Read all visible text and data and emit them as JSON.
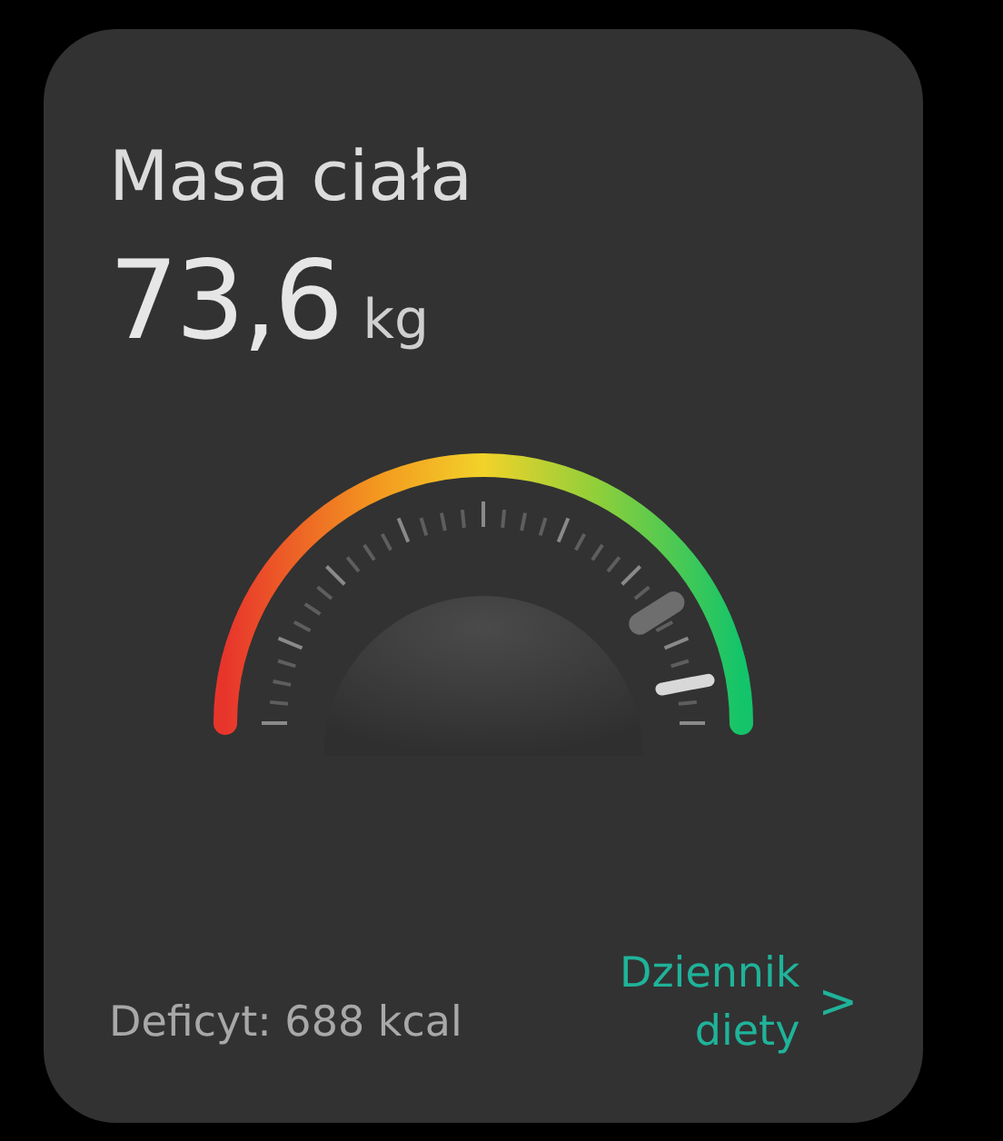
{
  "card": {
    "title": "Masa ciała",
    "value": "73,6",
    "unit": "kg"
  },
  "footer": {
    "deficit": "Deficyt: 688 kcal",
    "link": "Dziennik diety",
    "chevron": ">"
  }
}
